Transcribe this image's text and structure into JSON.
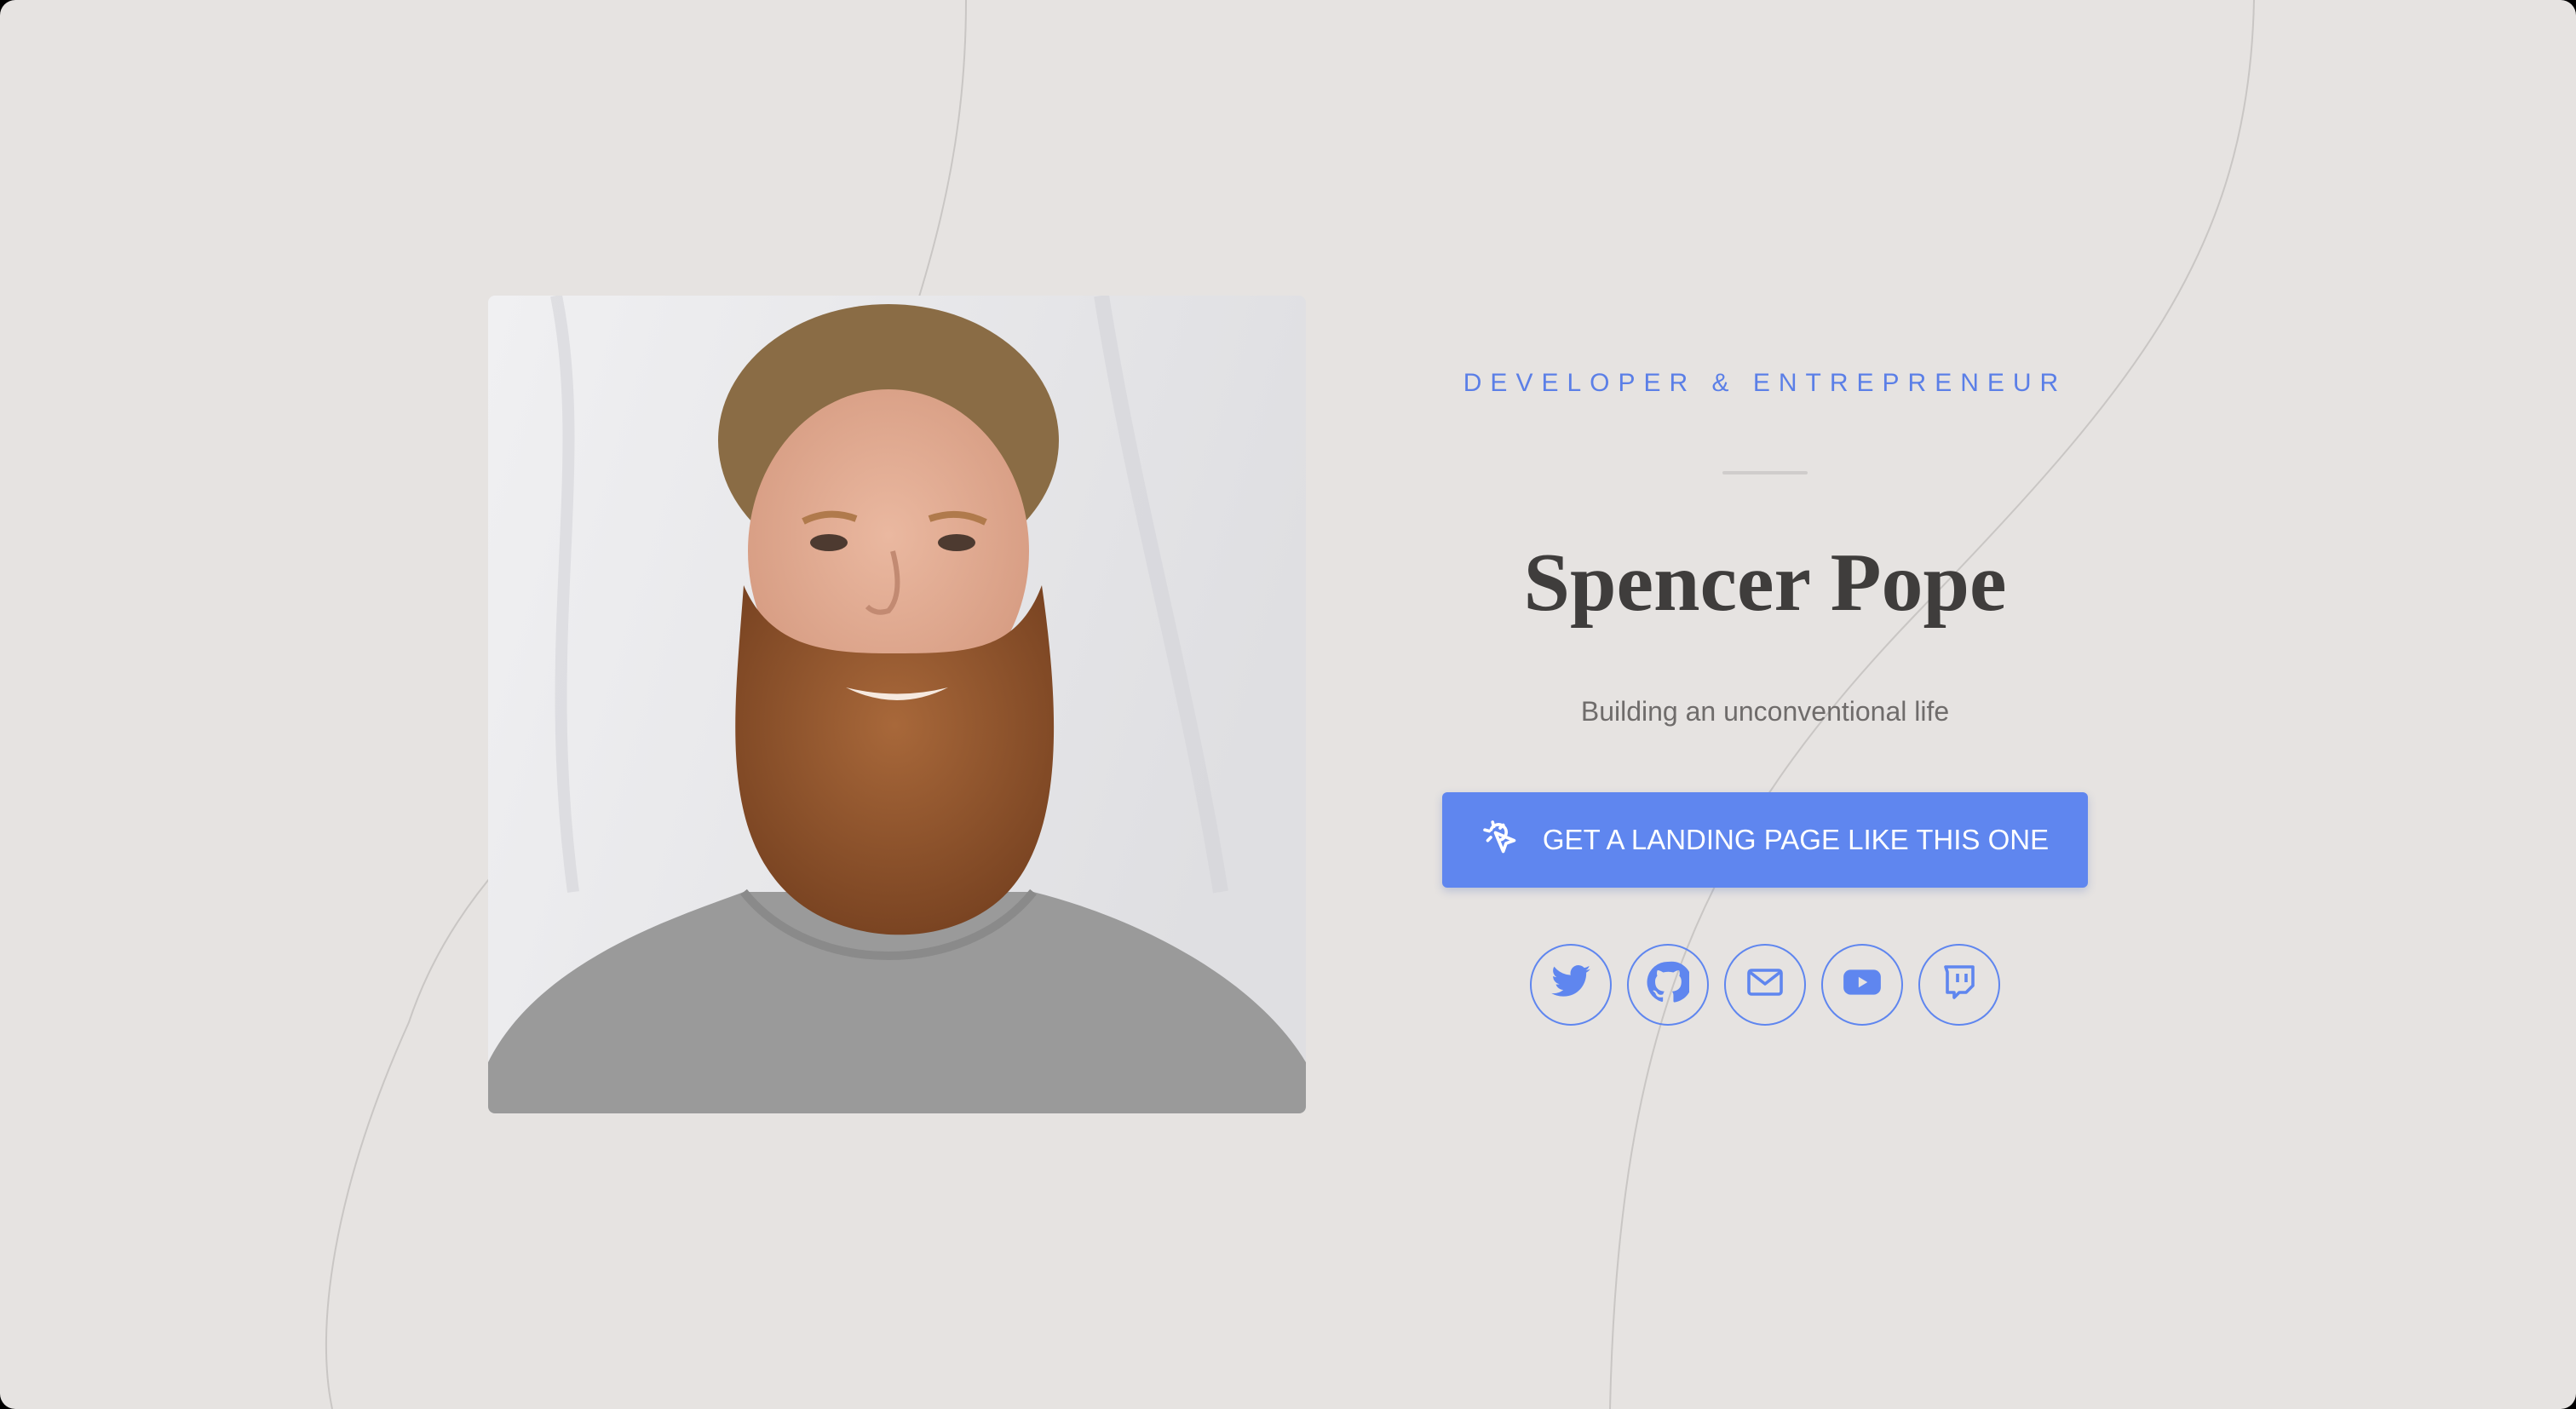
{
  "hero": {
    "kicker": "DEVELOPER & ENTREPRENEUR",
    "name": "Spencer Pope",
    "tagline": "Building an unconventional life",
    "cta_label": "GET A LANDING PAGE LIKE THIS ONE",
    "cta_icon": "cursor-click-icon"
  },
  "socials": [
    {
      "name": "twitter",
      "icon": "twitter-icon"
    },
    {
      "name": "github",
      "icon": "github-icon"
    },
    {
      "name": "email",
      "icon": "mail-icon"
    },
    {
      "name": "youtube",
      "icon": "youtube-icon"
    },
    {
      "name": "twitch",
      "icon": "twitch-icon"
    }
  ],
  "colors": {
    "background": "#e6e3e1",
    "accent": "#5f86ef",
    "heading": "#3f3d3c",
    "muted": "#6f6c6b"
  }
}
